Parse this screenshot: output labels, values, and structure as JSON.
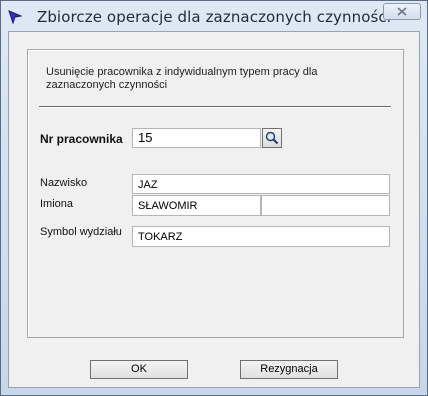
{
  "window": {
    "title": "Zbiorcze operacje dla zaznaczonych czynności",
    "app_icon": "arrow-cursor-icon",
    "close_icon": "close-icon"
  },
  "form": {
    "description": "Usunięcie pracownika z indywidualnym typem pracy dla zaznaczonych czynności",
    "employee_no_label": "Nr pracownika",
    "employee_no_value": "15",
    "search_icon": "search-icon",
    "surname_label": "Nazwisko",
    "surname_value": "JAZ",
    "first_names_label": "Imiona",
    "first_name_value": "SŁAWOMIR",
    "second_name_value": "",
    "department_label": "Symbol wydziału",
    "department_value": "TOKARZ"
  },
  "buttons": {
    "ok": "OK",
    "cancel": "Rezygnacja"
  }
}
